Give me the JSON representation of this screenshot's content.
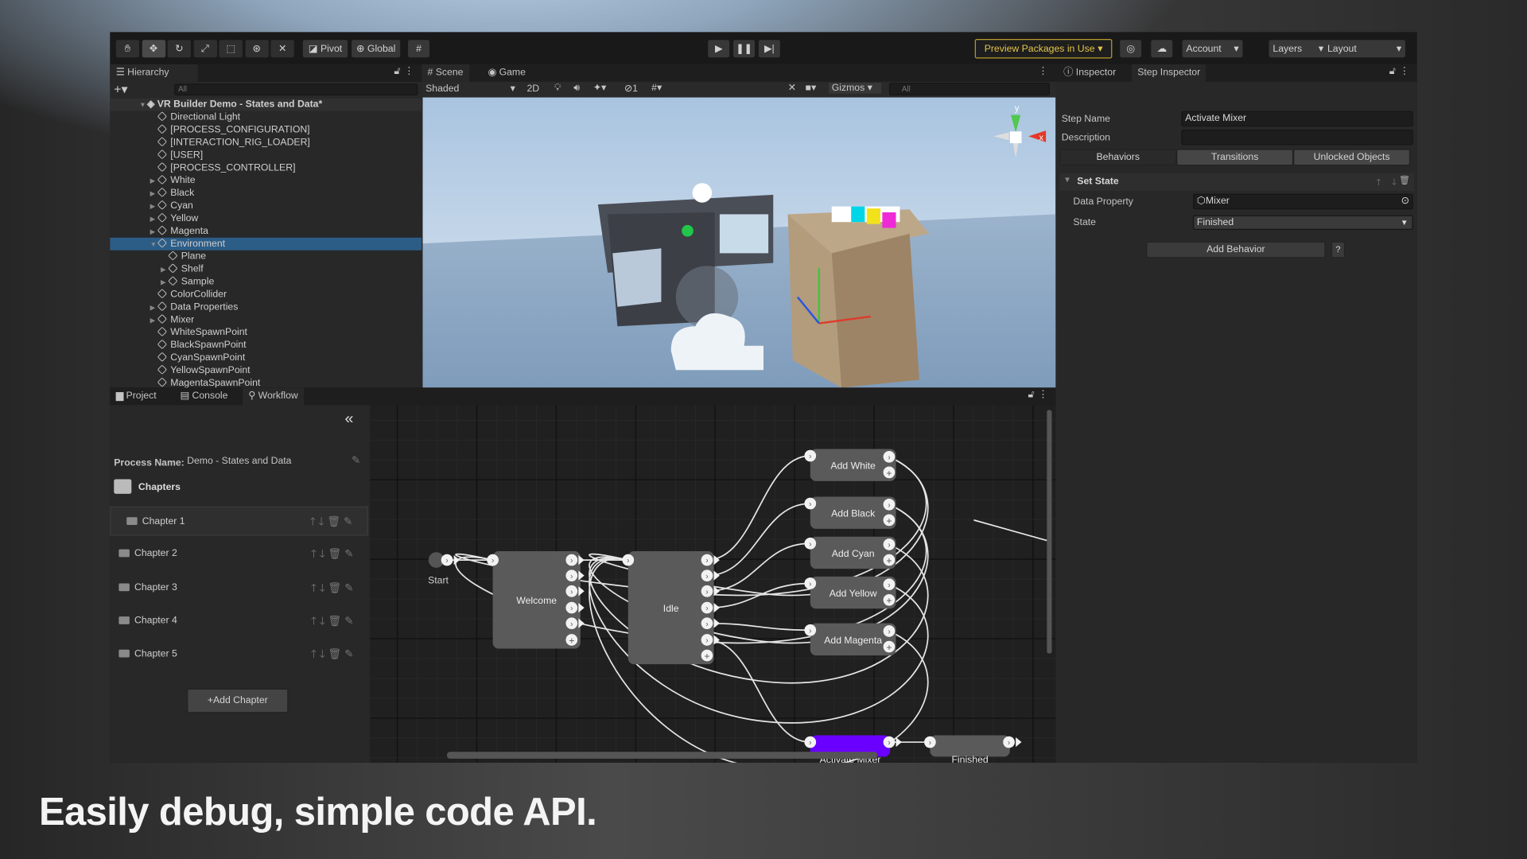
{
  "toolbar": {
    "pivot": "Pivot",
    "global": "Global",
    "preview_packages": "Preview Packages in Use",
    "account": "Account",
    "layers": "Layers",
    "layout": "Layout",
    "tools": [
      "hand-icon",
      "move-icon",
      "rotate-icon",
      "scale-icon",
      "rect-icon",
      "transform-icon",
      "custom-tool-icon"
    ]
  },
  "hierarchy": {
    "tab": "Hierarchy",
    "search_placeholder": "All",
    "scene": "VR Builder Demo - States and Data*",
    "items": [
      {
        "label": "Directional Light",
        "depth": 1,
        "arrow": false
      },
      {
        "label": "[PROCESS_CONFIGURATION]",
        "depth": 1,
        "arrow": false
      },
      {
        "label": "[INTERACTION_RIG_LOADER]",
        "depth": 1,
        "arrow": false
      },
      {
        "label": "[USER]",
        "depth": 1,
        "arrow": false
      },
      {
        "label": "[PROCESS_CONTROLLER]",
        "depth": 1,
        "arrow": false
      },
      {
        "label": "White",
        "depth": 1,
        "arrow": true
      },
      {
        "label": "Black",
        "depth": 1,
        "arrow": true
      },
      {
        "label": "Cyan",
        "depth": 1,
        "arrow": true
      },
      {
        "label": "Yellow",
        "depth": 1,
        "arrow": true
      },
      {
        "label": "Magenta",
        "depth": 1,
        "arrow": true
      },
      {
        "label": "Environment",
        "depth": 1,
        "arrow": true,
        "selected": true,
        "expanded": true
      },
      {
        "label": "Plane",
        "depth": 2,
        "arrow": false
      },
      {
        "label": "Shelf",
        "depth": 2,
        "arrow": true
      },
      {
        "label": "Sample",
        "depth": 2,
        "arrow": true
      },
      {
        "label": "ColorCollider",
        "depth": 1,
        "arrow": false
      },
      {
        "label": "Data Properties",
        "depth": 1,
        "arrow": true
      },
      {
        "label": "Mixer",
        "depth": 1,
        "arrow": true
      },
      {
        "label": "WhiteSpawnPoint",
        "depth": 1,
        "arrow": false
      },
      {
        "label": "BlackSpawnPoint",
        "depth": 1,
        "arrow": false
      },
      {
        "label": "CyanSpawnPoint",
        "depth": 1,
        "arrow": false
      },
      {
        "label": "YellowSpawnPoint",
        "depth": 1,
        "arrow": false
      },
      {
        "label": "MagentaSpawnPoint",
        "depth": 1,
        "arrow": false
      }
    ]
  },
  "scene": {
    "tab_scene": "Scene",
    "tab_game": "Game",
    "shading": "Shaded",
    "mode_2d": "2D",
    "layers_count": "1",
    "gizmos": "Gizmos",
    "search_placeholder": "All",
    "axis_y": "y",
    "axis_x": "x"
  },
  "bottom": {
    "tab_project": "Project",
    "tab_console": "Console",
    "tab_workflow": "Workflow"
  },
  "workflow": {
    "process_label": "Process Name:",
    "process_name": "Demo - States and Data",
    "chapters_label": "Chapters",
    "chapters": [
      "Chapter 1",
      "Chapter 2",
      "Chapter 3",
      "Chapter 4",
      "Chapter 5"
    ],
    "add_chapter": "+Add Chapter"
  },
  "graph": {
    "start": "Start",
    "nodes": {
      "welcome": "Welcome",
      "idle": "Idle",
      "white": "Add White",
      "black": "Add Black",
      "cyan": "Add Cyan",
      "yellow": "Add Yellow",
      "magenta": "Add Magenta",
      "mixer": "Activate Mixer",
      "finished": "Finished"
    },
    "colors": {
      "node": "#5a5a5a",
      "selected": "#6a00ff",
      "edge": "#e6e6e6"
    },
    "edges": [
      [
        "start",
        "welcome"
      ],
      [
        "welcome",
        "idle"
      ],
      [
        "idle",
        "white"
      ],
      [
        "idle",
        "black"
      ],
      [
        "idle",
        "cyan"
      ],
      [
        "idle",
        "yellow"
      ],
      [
        "idle",
        "magenta"
      ],
      [
        "idle",
        "mixer"
      ],
      [
        "white",
        "idle"
      ],
      [
        "black",
        "idle"
      ],
      [
        "cyan",
        "idle"
      ],
      [
        "yellow",
        "idle"
      ],
      [
        "magenta",
        "idle"
      ],
      [
        "white",
        "welcome"
      ],
      [
        "black",
        "welcome"
      ],
      [
        "mixer",
        "finished"
      ]
    ]
  },
  "inspector": {
    "tab_inspector": "Inspector",
    "tab_step": "Step Inspector",
    "step_name_label": "Step Name",
    "step_name": "Activate Mixer",
    "description_label": "Description",
    "description": "",
    "tabs": [
      "Behaviors",
      "Transitions",
      "Unlocked Objects"
    ],
    "behavior_title": "Set State",
    "data_property_label": "Data Property",
    "data_property": "Mixer",
    "state_label": "State",
    "state": "Finished",
    "add_behavior": "Add Behavior",
    "help": "?"
  },
  "caption": "Easily debug, simple code API."
}
